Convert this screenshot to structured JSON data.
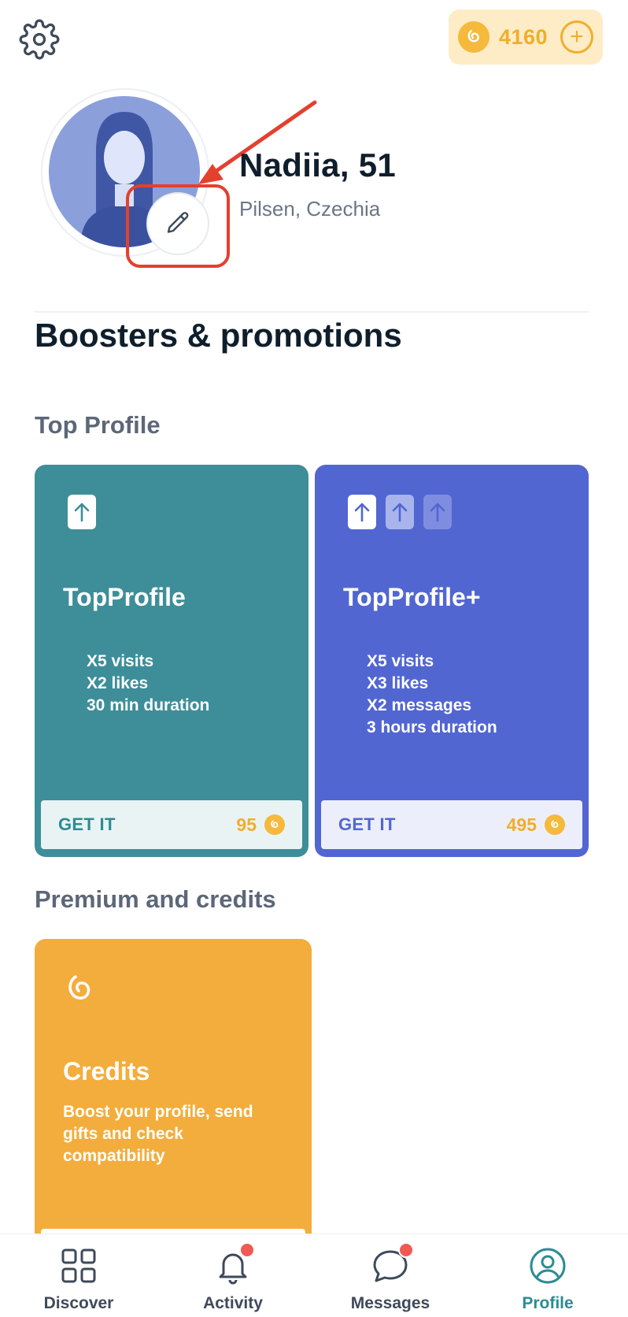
{
  "header": {
    "settings_icon": "gear-icon",
    "coins": "4160",
    "coin_icon": "coin-icon",
    "add_icon": "plus-circle-icon"
  },
  "profile": {
    "name": "Nadiia, 51",
    "location": "Pilsen, Czechia",
    "edit_icon": "pencil-icon"
  },
  "section": {
    "title": "Boosters & promotions"
  },
  "top_profile": {
    "label": "Top Profile",
    "cards": [
      {
        "name": "TopProfile",
        "features": [
          "X5 visits",
          "X2 likes",
          "30 min duration"
        ],
        "cta": "GET IT",
        "price": "95",
        "color": "#3d8e99"
      },
      {
        "name": "TopProfile+",
        "features": [
          "X5 visits",
          "X3 likes",
          "X2 messages",
          "3 hours duration"
        ],
        "cta": "GET IT",
        "price": "495",
        "color": "#5266d2"
      }
    ]
  },
  "premium": {
    "label": "Premium and credits",
    "card": {
      "title": "Credits",
      "description": "Boost your profile, send gifts and check compatibility",
      "color": "#f3ad3c"
    }
  },
  "nav": {
    "items": [
      {
        "label": "Discover",
        "icon": "grid-icon"
      },
      {
        "label": "Activity",
        "icon": "bell-icon"
      },
      {
        "label": "Messages",
        "icon": "chat-bubble-icon"
      },
      {
        "label": "Profile",
        "icon": "user-circle-icon"
      }
    ],
    "active": "Profile"
  },
  "colors": {
    "accent_teal": "#2c8b94",
    "coin_gold": "#f0ae2c",
    "annotation_red": "#e4402e",
    "notification_red": "#ef5a52"
  }
}
